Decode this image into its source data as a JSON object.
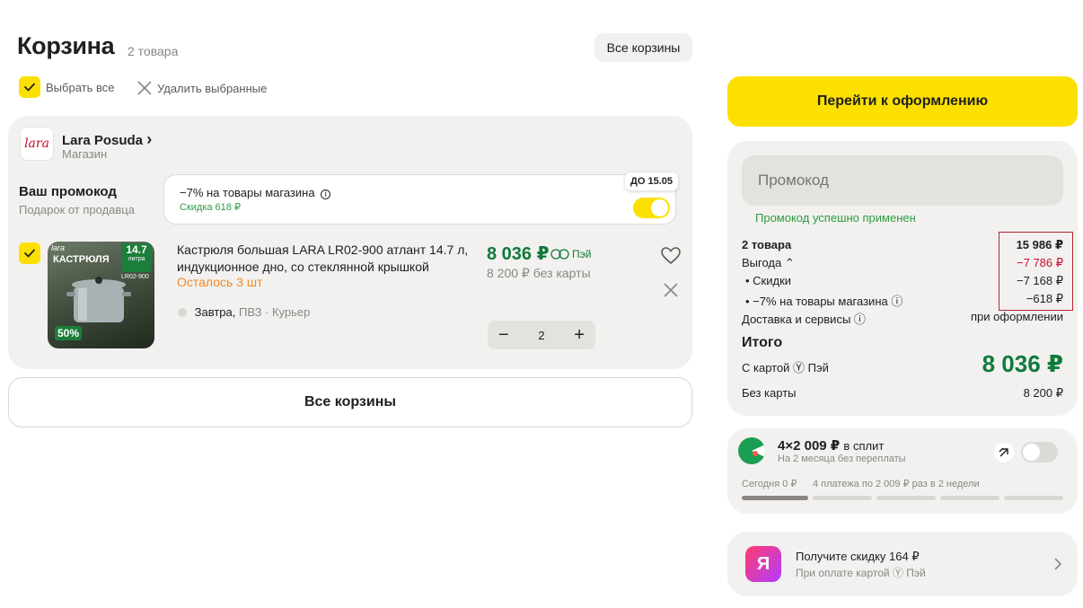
{
  "header": {
    "title": "Корзина",
    "items_count": "2 товара",
    "all_carts_label": "Все корзины",
    "select_all_label": "Выбрать все",
    "delete_selected_label": "Удалить выбранные"
  },
  "store": {
    "logo_text": "lara",
    "name": "Lara Posuda",
    "chevron": "›",
    "type": "Магазин"
  },
  "promo": {
    "label": "Ваш промокод",
    "sub": "Подарок от продавца",
    "title": "−7% на товары магазина",
    "discount": "Скидка 618 ₽",
    "deadline": "ДО 15.05",
    "enabled": true
  },
  "product": {
    "name": "Кастрюля большая LARA LR02-900 атлант 14.7 л, индукционное дно, со стеклянной крышкой",
    "stock": "Осталось 3 шт",
    "delivery_day": "Завтра,",
    "delivery_modes": "ПВЗ · Курьер",
    "price": "8 036 ₽",
    "pay_badge": "Пэй",
    "price_no_card": "8 200 ₽  без карты",
    "quantity": "2",
    "image_badge_volume": "14.7",
    "image_badge_unit": "литра",
    "image_title": "КАСТРЮЛЯ",
    "image_model": "LR02-900",
    "image_discount": "50%",
    "image_brand": "lara"
  },
  "footer_cart": {
    "all_carts_label": "Все корзины"
  },
  "summary": {
    "checkout_label": "Перейти к оформлению",
    "promo_placeholder": "Промокод",
    "promo_applied": "Промокод успешно применен",
    "lines": [
      {
        "label": "2 товара",
        "value": "15 986 ₽",
        "bold": true
      },
      {
        "label": "Выгода ⌃",
        "value": "−7 786 ₽",
        "red": true
      },
      {
        "label": "• Скидки",
        "value": "−7 168 ₽"
      },
      {
        "label": "• −7% на товары магазина ⓘ",
        "value": "−618 ₽"
      },
      {
        "label": "Доставка и сервисы ⓘ",
        "value": "при оформлении"
      }
    ],
    "total_label": "Итого",
    "card_label": "С картой Ⓨ Пэй",
    "total_price": "8 036 ₽",
    "no_card_label": "Без карты",
    "no_card_value": "8 200 ₽"
  },
  "split": {
    "title": "4×2 009 ₽",
    "title_suffix": "в сплит",
    "sub": "На 2 месяца без переплаты",
    "today": "Сегодня 0 ₽",
    "plan": "4 платежа по 2 009 ₽ раз в 2 недели",
    "enabled": false
  },
  "promo_card": {
    "logo": "Я",
    "title": "Получите скидку 164 ₽",
    "sub": "При оплате картой Ⓨ Пэй"
  },
  "colors": {
    "accent_yellow": "#fce000",
    "price_green": "#107a3b",
    "success_green": "#2c9b3f",
    "warning_orange": "#f08a24",
    "discount_red": "#c8102e",
    "panel_bg": "#f2f1ef"
  }
}
